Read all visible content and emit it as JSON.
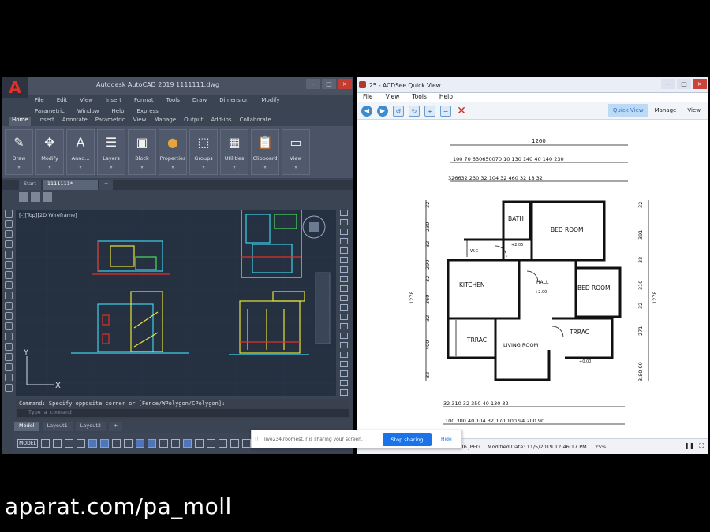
{
  "autocad": {
    "app_logo": "A",
    "title": "Autodesk AutoCAD 2019    1111111.dwg",
    "menu_row1": [
      "File",
      "Edit",
      "View",
      "Insert",
      "Format",
      "Tools",
      "Draw",
      "Dimension",
      "Modify"
    ],
    "menu_row2": [
      "Parametric",
      "Window",
      "Help",
      "Express"
    ],
    "ribbon_tabs": [
      "Home",
      "Insert",
      "Annotate",
      "Parametric",
      "View",
      "Manage",
      "Output",
      "Add-ins",
      "Collaborate"
    ],
    "ribbon_buttons": [
      {
        "label": "Draw",
        "icon": "pencil-icon"
      },
      {
        "label": "Modify",
        "icon": "move-icon"
      },
      {
        "label": "Anno...",
        "icon": "text-icon"
      },
      {
        "label": "Layers",
        "icon": "layers-icon"
      },
      {
        "label": "Block",
        "icon": "block-icon"
      },
      {
        "label": "Properties",
        "icon": "palette-icon"
      },
      {
        "label": "Groups",
        "icon": "group-icon"
      },
      {
        "label": "Utilities",
        "icon": "calculator-icon"
      },
      {
        "label": "Clipboard",
        "icon": "clipboard-icon"
      },
      {
        "label": "View",
        "icon": "view-icon"
      }
    ],
    "file_tabs": {
      "start": "Start",
      "current": "1111111*",
      "add": "+"
    },
    "view_label": "[-][Top][2D Wireframe]",
    "axis_y": "Y",
    "axis_x": "X",
    "command_line": "Command: Specify opposite corner or [Fence/WPolygon/CPolygon]:",
    "command_placeholder": "Type a command",
    "layout_tabs": [
      "Model",
      "Layout1",
      "Layout2"
    ],
    "layout_add": "+",
    "status_model": "MODEL"
  },
  "acdsee": {
    "title": "25 - ACDSee Quick View",
    "menu": [
      "File",
      "View",
      "Tools",
      "Help"
    ],
    "modes": [
      "Quick View",
      "Manage",
      "View"
    ],
    "status_format": "Mb JPEG",
    "status_modified": "Modified Date: 11/5/2019 12:46:17 PM",
    "status_zoom": "25%",
    "plan": {
      "top_total": "1260",
      "top_row1": "100 70 630650070 10 130 140 40 140 230",
      "top_row2": "326632 230 32 104 32 460 32 18 32",
      "rooms": [
        "BATH",
        "BED ROOM",
        "W.C",
        "KITCHEN",
        "HALL",
        "BED ROOM",
        "TRRAC",
        "LIVING ROOM",
        "TRRAC"
      ],
      "level_hall": "+2.00",
      "level_bath": "+2.05",
      "level_out": "+0.00",
      "left_dims": [
        "32",
        "230",
        "32",
        "290",
        "32",
        "360",
        "32",
        "400",
        "32"
      ],
      "left_total": "1278",
      "right_dims": [
        "32",
        "391",
        "32",
        "310",
        "32",
        "271",
        "3.80 00"
      ],
      "right_total": "1278",
      "bottom_row1": "32 310 32 350 40 130 32",
      "bottom_row2": "100 300 40 104 32 170 100 94 200 90"
    }
  },
  "share_bar": {
    "message": "live234.roomest.ir is sharing your screen.",
    "stop_label": "Stop sharing",
    "hide_label": "Hide"
  },
  "watermark": "aparat.com/pa_moll",
  "colors": {
    "cad_bg": "#253040",
    "cad_cyan": "#3fd0ea",
    "cad_yellow": "#e8e23a",
    "cad_red": "#e0302a",
    "cad_green": "#4ddc5a",
    "share_blue": "#1a73e8"
  }
}
